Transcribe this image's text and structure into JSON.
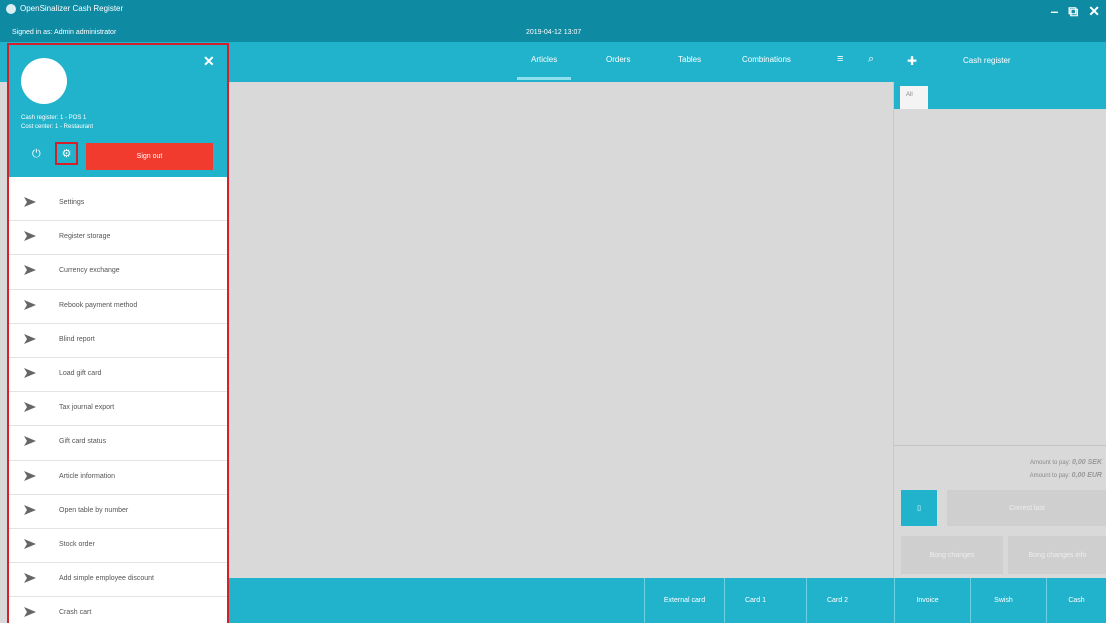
{
  "window": {
    "title": "OpenSinalizer Cash Register",
    "signed_in": "Signed in as: Admin administrator",
    "datetime": "2019-04-12 13:07",
    "controls": {
      "minimize": "–",
      "restore": "⧉",
      "close": "✕"
    }
  },
  "nav": {
    "tabs": [
      {
        "label": "Articles",
        "active": true
      },
      {
        "label": "Orders"
      },
      {
        "label": "Tables"
      },
      {
        "label": "Combinations"
      }
    ],
    "icons": [
      "sort-icon",
      "search-icon"
    ]
  },
  "side_menu": {
    "cash_register": "Cash register: 1 - POS 1",
    "cost_center": "Cost center: 1 - Restaurant",
    "sign_out": "Sign out",
    "items": [
      "Settings",
      "Register storage",
      "Currency exchange",
      "Rebook payment method",
      "Blind report",
      "Load gift card",
      "Tax journal export",
      "Gift card status",
      "Article information",
      "Open table by number",
      "Stock order",
      "Add simple employee discount",
      "Crash cart"
    ]
  },
  "right_panel": {
    "header": "Cash register",
    "tab_all": "All",
    "amount_sek_label": "Amount to pay:",
    "amount_sek": "0,00 SEK",
    "amount_eur_label": "Amount to pay:",
    "amount_eur": "0,00 EUR",
    "correct_last": "Correct last",
    "bong_changes": "Bong changes",
    "bong_changes_info": "Bong changes info"
  },
  "payment": {
    "buttons": [
      "External card",
      "Card 1",
      "Card 2",
      "Invoice",
      "Swish",
      "Cash"
    ]
  },
  "colors": {
    "primary": "#21b3cb",
    "titlebar": "#0e8aa3",
    "signout": "#f13b2e",
    "highlight": "#d4202a"
  }
}
